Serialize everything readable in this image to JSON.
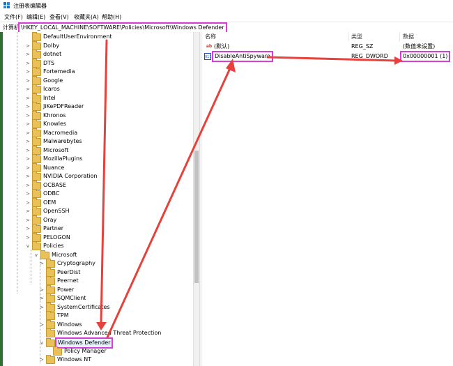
{
  "window": {
    "title": "注册表编辑器"
  },
  "menu": [
    "文件(F)",
    "编辑(E)",
    "查看(V)",
    "收藏夹(A)",
    "帮助(H)"
  ],
  "address": {
    "label": "计算机",
    "path": "\\HKEY_LOCAL_MACHINE\\SOFTWARE\\Policies\\Microsoft\\Windows Defender"
  },
  "tree": {
    "items": [
      {
        "label": "DefaultUserEnvironment",
        "expander": ""
      },
      {
        "label": "Dolby",
        "expander": ">"
      },
      {
        "label": "dotnet",
        "expander": ">"
      },
      {
        "label": "DTS",
        "expander": ">"
      },
      {
        "label": "Fortemedia",
        "expander": ">"
      },
      {
        "label": "Google",
        "expander": ">"
      },
      {
        "label": "Icaros",
        "expander": ">"
      },
      {
        "label": "Intel",
        "expander": ">"
      },
      {
        "label": "JiKePDFReader",
        "expander": ">"
      },
      {
        "label": "Khronos",
        "expander": ">"
      },
      {
        "label": "Knowles",
        "expander": ">"
      },
      {
        "label": "Macromedia",
        "expander": ">"
      },
      {
        "label": "Malwarebytes",
        "expander": ">"
      },
      {
        "label": "Microsoft",
        "expander": ">"
      },
      {
        "label": "MozillaPlugins",
        "expander": ">"
      },
      {
        "label": "Nuance",
        "expander": ">"
      },
      {
        "label": "NVIDIA Corporation",
        "expander": ">"
      },
      {
        "label": "OCBASE",
        "expander": ">"
      },
      {
        "label": "ODBC",
        "expander": ">"
      },
      {
        "label": "OEM",
        "expander": ">"
      },
      {
        "label": "OpenSSH",
        "expander": ">"
      },
      {
        "label": "Oray",
        "expander": ">"
      },
      {
        "label": "Partner",
        "expander": ">"
      },
      {
        "label": "PELOGON",
        "expander": ">"
      },
      {
        "label": "Policies",
        "expander": "v"
      },
      {
        "label": "Microsoft",
        "expander": "v"
      },
      {
        "label": "Cryptography",
        "expander": ">"
      },
      {
        "label": "PeerDist",
        "expander": ""
      },
      {
        "label": "Peernet",
        "expander": ""
      },
      {
        "label": "Power",
        "expander": ">"
      },
      {
        "label": "SQMClient",
        "expander": ">"
      },
      {
        "label": "SystemCertificates",
        "expander": ">"
      },
      {
        "label": "TPM",
        "expander": ""
      },
      {
        "label": "Windows",
        "expander": ">"
      },
      {
        "label": "Windows Advanced Threat Protection",
        "expander": ""
      },
      {
        "label": "Windows Defender",
        "expander": "v"
      },
      {
        "label": "Policy Manager",
        "expander": ""
      },
      {
        "label": "Windows NT",
        "expander": ">"
      }
    ]
  },
  "values": {
    "headers": {
      "name": "名称",
      "type": "类型",
      "data": "数据"
    },
    "rows": [
      {
        "icon": "string-value-icon",
        "name": "(默认)",
        "type": "REG_SZ",
        "data": "(数值未设置)"
      },
      {
        "icon": "binary-value-icon",
        "name": "DisableAntiSpyware",
        "type": "REG_DWORD",
        "data": "0x00000001 (1)"
      }
    ]
  },
  "colors": {
    "annotation": "#e8403a",
    "highlight": "#d63fd6",
    "selection": "#cce8ff"
  }
}
